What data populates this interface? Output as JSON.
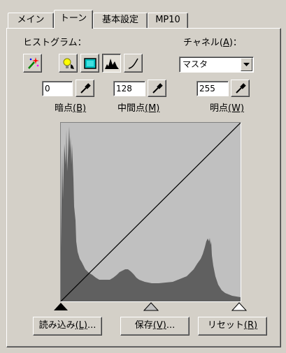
{
  "tabs": [
    {
      "label": "メイン",
      "active": false
    },
    {
      "label": "トーン",
      "active": true
    },
    {
      "label": "基本設定",
      "active": false
    },
    {
      "label": "MP10",
      "active": false
    }
  ],
  "histogram_label": "ヒストグラム：",
  "channel": {
    "label": "チャネル(",
    "accel": "A",
    "label_end": ")：",
    "selected": "マスタ"
  },
  "points": {
    "shadow": {
      "value": "0",
      "label": "暗点",
      "accel": "(B)"
    },
    "mid": {
      "value": "128",
      "label": "中間点",
      "accel": "(M)"
    },
    "highlight": {
      "value": "255",
      "label": "明点",
      "accel": "(W)"
    }
  },
  "buttons": {
    "load": {
      "label": "読み込み",
      "accel": "(L)",
      "suffix": "..."
    },
    "save": {
      "label": "保存",
      "accel": "(V)",
      "suffix": "..."
    },
    "reset": {
      "label": "リセット",
      "accel": "(R)",
      "suffix": ""
    }
  },
  "icons": {
    "auto": "magic-wand-icon",
    "brightness": "bulb-icon",
    "contrast": "rect-icon",
    "histogram_mode": "histogram-icon",
    "curve_mode": "curve-icon",
    "eyedropper": "eyedropper-icon"
  },
  "colors": {
    "face": "#d4d0c8",
    "histogram_fill": "#606060",
    "graph_bg": "#c0c0c0"
  }
}
